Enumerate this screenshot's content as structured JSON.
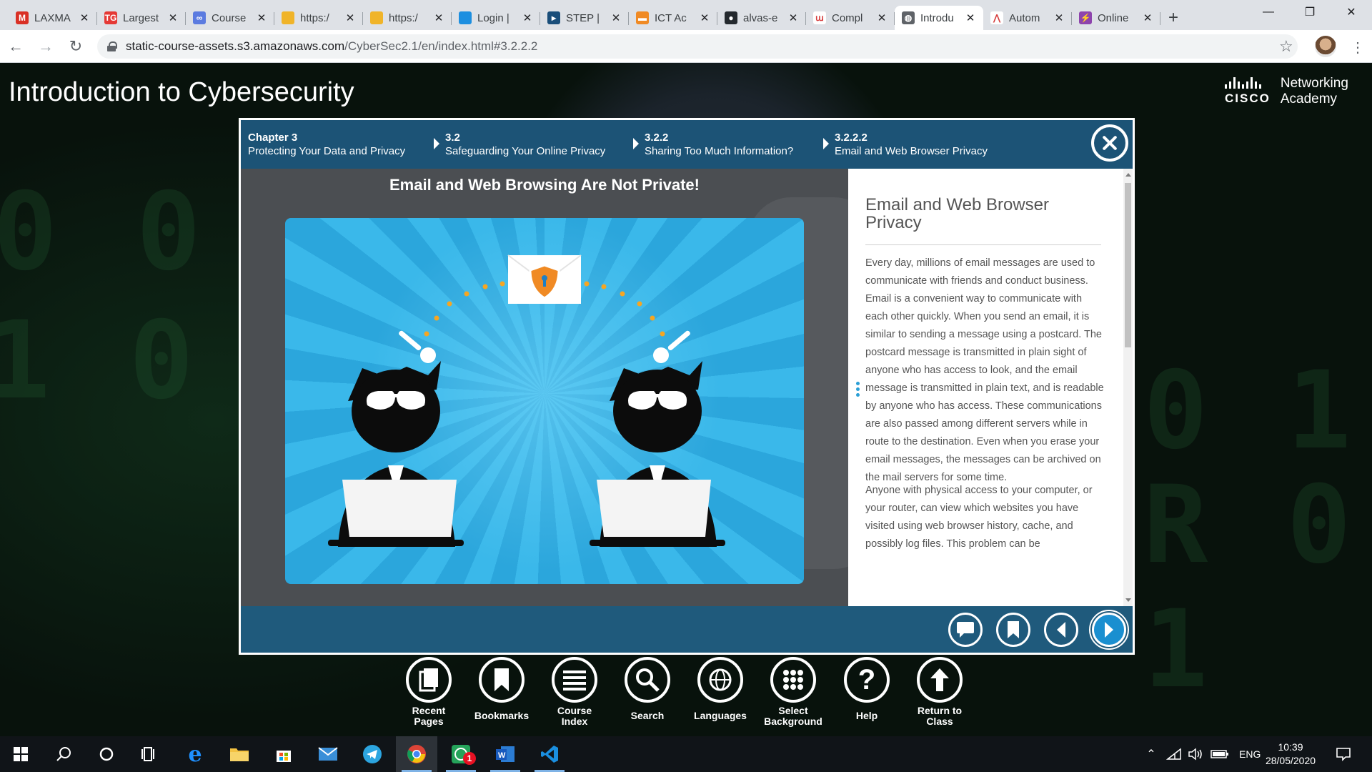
{
  "browser": {
    "tabs": [
      {
        "title": "LAXMA",
        "icon": "gmail-icon",
        "color": "#d93025",
        "glyph": "M"
      },
      {
        "title": "Largest",
        "icon": "tg-icon",
        "color": "#e53935",
        "glyph": "TG"
      },
      {
        "title": "Course",
        "icon": "link-icon",
        "color": "#5b7be0",
        "glyph": "∞"
      },
      {
        "title": "https:/",
        "icon": "db-icon",
        "color": "#f0b429",
        "glyph": ""
      },
      {
        "title": "https:/",
        "icon": "db-icon",
        "color": "#f0b429",
        "glyph": ""
      },
      {
        "title": "Login |",
        "icon": "cloud-icon",
        "color": "#1d8fe0",
        "glyph": ""
      },
      {
        "title": "STEP |",
        "icon": "step-icon",
        "color": "#1a4e7a",
        "glyph": "▸"
      },
      {
        "title": "ICT Ac",
        "icon": "ict-icon",
        "color": "#f08a24",
        "glyph": "▬"
      },
      {
        "title": "alvas-e",
        "icon": "github-icon",
        "color": "#24292e",
        "glyph": "●"
      },
      {
        "title": "Compl",
        "icon": "compl-icon",
        "color": "#ffffff",
        "glyph": "ա"
      },
      {
        "title": "Introdu",
        "icon": "globe-icon",
        "color": "#5f6368",
        "glyph": "◍",
        "active": true
      },
      {
        "title": "Autom",
        "icon": "autom-icon",
        "color": "#ffffff",
        "glyph": "⋀"
      },
      {
        "title": "Online",
        "icon": "bolt-icon",
        "color": "#8e44ad",
        "glyph": "⚡"
      }
    ],
    "url_host": "static-course-assets.s3.amazonaws.com",
    "url_path": "/CyberSec2.1/en/index.html#3.2.2.2"
  },
  "page": {
    "course_title": "Introduction to Cybersecurity",
    "logo_brand": "cisco",
    "logo_line1": "Networking",
    "logo_line2": "Academy"
  },
  "breadcrumb": [
    {
      "top": "Chapter 3",
      "bottom": "Protecting Your Data and Privacy"
    },
    {
      "top": "3.2",
      "bottom": "Safeguarding Your Online Privacy"
    },
    {
      "top": "3.2.2",
      "bottom": "Sharing Too Much Information?"
    },
    {
      "top": "3.2.2.2",
      "bottom": "Email and Web Browser Privacy"
    }
  ],
  "content": {
    "media_title": "Email and Web Browsing Are Not Private!",
    "heading": "Email and Web Browser Privacy",
    "paragraph1": "Every day, millions of email messages are used to communicate with friends and conduct business. Email is a convenient way to communicate with each other quickly. When you send an email, it is similar to sending a message using a postcard. The postcard message is transmitted in plain sight of anyone who has access to look, and the email message is transmitted in plain text, and is readable by anyone who has access. These communications are also passed among different servers while in route to the destination. Even when you erase your email messages, the messages can be archived on the mail servers for some time.",
    "paragraph2": "Anyone with physical access to your computer, or your router, can view which websites you have visited using web browser history, cache, and possibly log files. This problem can be"
  },
  "footer_buttons": [
    "comment-icon",
    "bookmark-icon",
    "previous-icon",
    "next-icon"
  ],
  "course_nav": [
    {
      "label1": "Recent",
      "label2": "Pages",
      "icon": "recent-pages-icon"
    },
    {
      "label1": "Bookmarks",
      "label2": "",
      "icon": "bookmarks-icon"
    },
    {
      "label1": "Course",
      "label2": "Index",
      "icon": "course-index-icon"
    },
    {
      "label1": "Search",
      "label2": "",
      "icon": "search-icon"
    },
    {
      "label1": "Languages",
      "label2": "",
      "icon": "languages-icon"
    },
    {
      "label1": "Select",
      "label2": "Background",
      "icon": "select-background-icon"
    },
    {
      "label1": "Help",
      "label2": "",
      "icon": "help-icon"
    },
    {
      "label1": "Return to",
      "label2": "Class",
      "icon": "return-icon"
    }
  ],
  "taskbar": {
    "language": "ENG",
    "time": "10:39",
    "date": "28/05/2020",
    "whatsapp_badge": "1"
  }
}
